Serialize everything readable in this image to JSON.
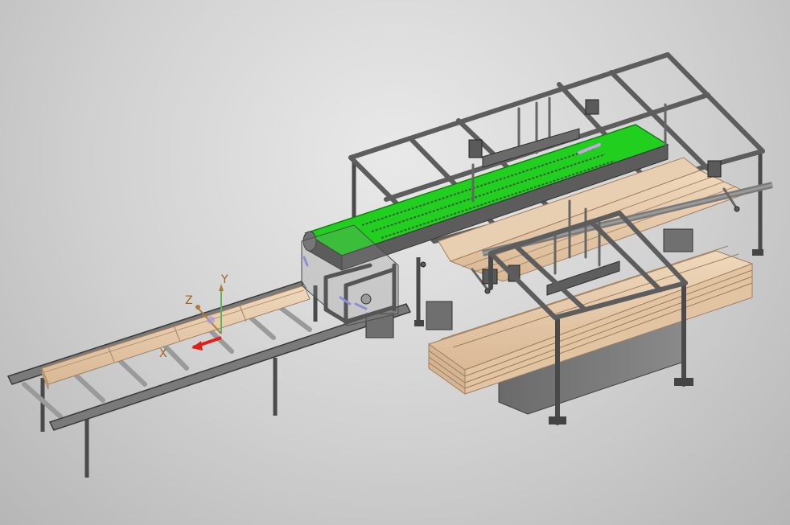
{
  "triad": {
    "x_label": "X",
    "y_label": "Y",
    "z_label": "Z"
  },
  "colors": {
    "belt": "#22d11f",
    "wood": "#e6c9a8",
    "wood_edge": "#b89a7b",
    "steel": "#6c6c6c",
    "steel_dark": "#3d3d3d",
    "axis_x": "#e0201b",
    "axis_label": "#a5641c",
    "axis_z": "#b07b3a",
    "axis_y": "#63b05a"
  }
}
